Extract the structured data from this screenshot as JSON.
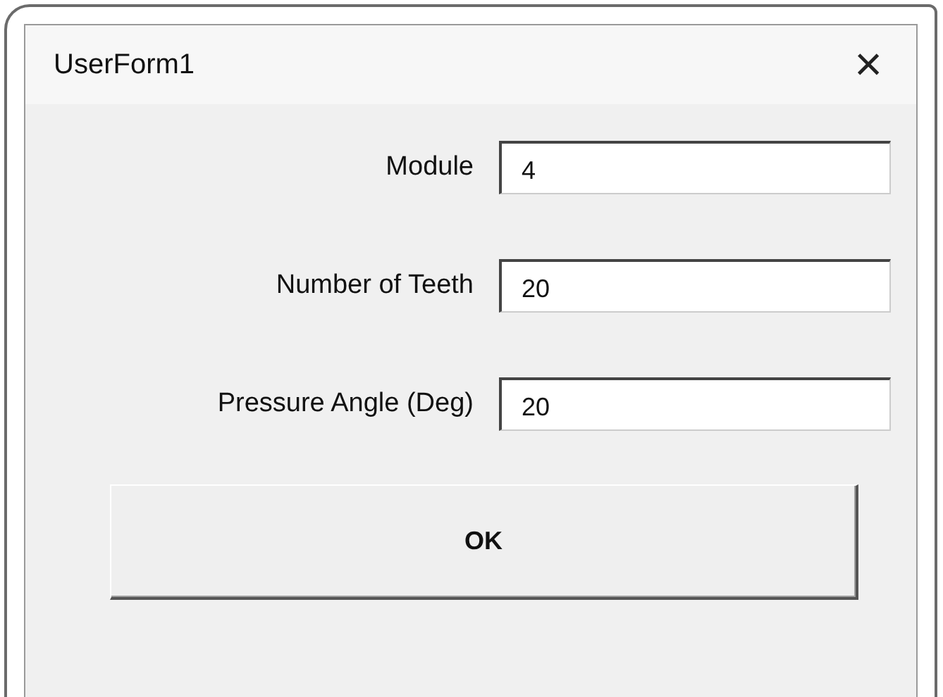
{
  "window": {
    "title": "UserForm1",
    "close": "×"
  },
  "fields": [
    {
      "label": "Module",
      "value": "4"
    },
    {
      "label": "Number of Teeth",
      "value": "20"
    },
    {
      "label": "Pressure Angle (Deg)",
      "value": "20"
    }
  ],
  "buttons": [
    "OK"
  ]
}
